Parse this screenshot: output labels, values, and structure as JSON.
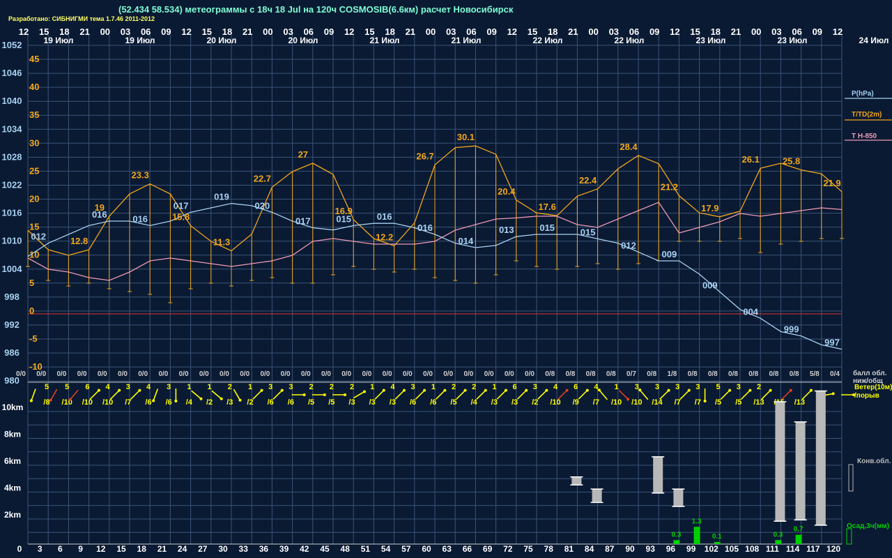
{
  "header": {
    "title": "(52.434 58.534) метеограммы с  18ч 18 Jul на 120ч COSMOSIB(6.6км) расчет Новосибирск",
    "credit": "Разработано: СИБНИГМИ тема 1.7.46 2011-2012"
  },
  "colors": {
    "bg": "#0a1a33",
    "grid": "#3a5478",
    "pressure": "#a8d0f0",
    "temperature": "#f2a71b",
    "t850": "#ef9ab4",
    "wind_yellow": "#ffff00",
    "wind_red": "#e04020",
    "precip": "#00d000",
    "cloud": "#b8b8b8",
    "zero": "#b83030"
  },
  "chart_data": {
    "type": "line",
    "hours_top": [
      "12",
      "15",
      "18",
      "21",
      "00",
      "03",
      "06",
      "09",
      "12",
      "15",
      "18",
      "21",
      "00",
      "03",
      "06",
      "09",
      "12",
      "15",
      "18",
      "21",
      "00",
      "03",
      "06",
      "09",
      "12",
      "15",
      "18",
      "21",
      "00",
      "03",
      "06",
      "09",
      "12",
      "15",
      "18",
      "21",
      "00",
      "03",
      "06",
      "09",
      "12"
    ],
    "date_labels": [
      "19 Июл",
      "19 Июл",
      "20 Июл",
      "20 Июл",
      "21 Июл",
      "21 Июл",
      "22 Июл",
      "22 Июл",
      "23 Июл",
      "23 Июл",
      "24 Июл"
    ],
    "pressure_ticks": [
      "1052",
      "1046",
      "1040",
      "1034",
      "1028",
      "1022",
      "1016",
      "1010",
      "1004",
      "998",
      "992",
      "986",
      "980"
    ],
    "temp_ticks": [
      "45",
      "40",
      "35",
      "30",
      "25",
      "20",
      "15",
      "10",
      "5",
      "0",
      "-5",
      "-10"
    ],
    "height_ticks": [
      "10km",
      "8km",
      "6km",
      "4km",
      "2km"
    ],
    "forecast_hours": [
      "0",
      "3",
      "6",
      "9",
      "12",
      "15",
      "18",
      "21",
      "24",
      "27",
      "30",
      "33",
      "36",
      "39",
      "42",
      "45",
      "48",
      "51",
      "54",
      "57",
      "60",
      "63",
      "66",
      "69",
      "72",
      "75",
      "78",
      "81",
      "84",
      "87",
      "90",
      "93",
      "96",
      "99",
      "102",
      "105",
      "108",
      "111",
      "114",
      "117",
      "120"
    ],
    "legend": {
      "pressure": "P(hPa)",
      "temperature": "T/TD(2m)",
      "t850": "T H-850",
      "clouds": "балл обл.",
      "clouds_sub": "ниж/общ",
      "wind": "Ветер(10м)",
      "gust": "/порыв",
      "conv": "Конв.обл.",
      "precip": "Осад,3ч(мм)"
    },
    "temperature": [
      15,
      11.5,
      10.5,
      11.5,
      17.5,
      21.5,
      23.3,
      21.5,
      15.8,
      13,
      11.3,
      14.3,
      22.7,
      25.5,
      27,
      25,
      16.9,
      13.5,
      12.2,
      16.3,
      26.7,
      29.8,
      30.1,
      28.6,
      20.4,
      18.1,
      17.6,
      21.1,
      22.4,
      26,
      28.4,
      26.9,
      21.2,
      18.1,
      17.4,
      18.4,
      26.1,
      27,
      25.8,
      25.1,
      21.9
    ],
    "temperature_labels": {
      "3": "12.8",
      "4": "19",
      "6": "23.3",
      "8": "15.8",
      "10": "11.3",
      "12": "22.7",
      "14": "27",
      "16": "16.9",
      "18": "12.2",
      "20": "26.7",
      "22": "30.1",
      "24": "20.4",
      "26": "17.6",
      "28": "22.4",
      "30": "28.4",
      "32": "21.2",
      "34": "17.9",
      "36": "26.1",
      "38": "25.8",
      "40": "21.9"
    },
    "dewpoint": [
      8.5,
      6,
      5,
      5.5,
      4.5,
      4,
      3.5,
      2,
      4.5,
      5.5,
      5,
      6,
      6.5,
      5.5,
      5.5,
      7,
      8.5,
      8,
      7.5,
      8,
      6.5,
      6,
      5.5,
      7,
      9.5,
      8.5,
      8,
      8.5,
      9,
      8,
      9,
      9.5,
      13,
      13,
      13,
      13.5,
      11,
      12.5,
      13,
      13.5,
      13.5
    ],
    "t850": [
      10,
      8,
      7.5,
      6.5,
      6,
      7.5,
      9.5,
      10,
      9.5,
      9,
      8.5,
      9,
      9.5,
      10.5,
      13,
      13.5,
      13,
      12.5,
      12.5,
      12.5,
      13,
      15,
      16,
      17,
      17.2,
      17.5,
      17.5,
      16,
      15.5,
      17,
      18.5,
      20,
      14.5,
      15.5,
      16.5,
      18,
      17.5,
      18,
      18.5,
      19,
      18.7
    ],
    "pressure": [
      1010,
      1013,
      1015,
      1017,
      1018,
      1018,
      1017,
      1018,
      1020,
      1021,
      1022,
      1021.5,
      1020,
      1018,
      1016.5,
      1016,
      1017,
      1017.5,
      1017.5,
      1016.5,
      1015,
      1013,
      1012,
      1012.5,
      1014.5,
      1015,
      1015,
      1015,
      1014,
      1013,
      1011,
      1009,
      1009,
      1006,
      1002,
      998,
      996,
      993,
      992,
      990,
      989
    ],
    "pressure_labels": {
      "1": "012",
      "4": "016",
      "6": "016",
      "8": "017",
      "10": "019",
      "12": "020",
      "14": "017",
      "16": "015",
      "18": "016",
      "20": "016",
      "22": "014",
      "24": "013",
      "26": "015",
      "28": "015",
      "30": "012",
      "32": "009",
      "34": "009",
      "36": "004",
      "38": "999",
      "40": "997"
    },
    "cloud_cover": [
      "0/0",
      "0/0",
      "0/0",
      "0/0",
      "0/0",
      "0/0",
      "0/0",
      "0/0",
      "0/0",
      "0/0",
      "0/0",
      "0/0",
      "0/0",
      "0/0",
      "0/0",
      "0/0",
      "0/0",
      "0/0",
      "0/0",
      "0/0",
      "0/0",
      "0/0",
      "0/0",
      "0/0",
      "0/0",
      "0/0",
      "0/8",
      "0/8",
      "0/8",
      "0/8",
      "0/7",
      "0/8",
      "1/8",
      "0/8",
      "0/8",
      "0/8",
      "0/8",
      "0/8",
      "0/8",
      "5/8",
      "0/4"
    ],
    "wind_speed": [
      "5",
      "5",
      "6",
      "4",
      "3",
      "4",
      "3",
      "1",
      "1",
      "2",
      "1",
      "3",
      "3",
      "2",
      "2",
      "2",
      "1",
      "4",
      "3",
      "1",
      "2",
      "2",
      "1",
      "6",
      "3",
      "4",
      "6",
      "4",
      "1",
      "3",
      "3",
      "3",
      "3",
      "5",
      "3",
      "2"
    ],
    "wind_gust": [
      "/8",
      "/10",
      "/10",
      "/10",
      "/7",
      "/6",
      "/6",
      "/4",
      "/2",
      "/3",
      "/2",
      "/6",
      "/6",
      "/5",
      "/5",
      "/3",
      "/3",
      "/3",
      "/6",
      "/6",
      "/5",
      "/4",
      "/3",
      "/3",
      "/2",
      "/10",
      "/9",
      "/7",
      "/10",
      "/10",
      "/14",
      "/7",
      "/7",
      "/5",
      "/5",
      "/13",
      "/15",
      "/13",
      "/4"
    ],
    "wind_dir": [
      200,
      210,
      220,
      45,
      45,
      45,
      200,
      180,
      130,
      130,
      150,
      45,
      45,
      90,
      90,
      90,
      60,
      45,
      45,
      45,
      45,
      45,
      45,
      45,
      45,
      45,
      45,
      45,
      320,
      135,
      320,
      45,
      45,
      180,
      45,
      45,
      45,
      45,
      45,
      80,
      90
    ],
    "convective_clouds_km": {
      "27": [
        4.4,
        5.0
      ],
      "28": [
        3.1,
        4.1
      ],
      "31": [
        3.8,
        6.5
      ],
      "32": [
        2.8,
        4.1
      ],
      "37": [
        1.7,
        10.6
      ],
      "38": [
        1.8,
        9.1
      ],
      "39": [
        1.4,
        11.4
      ]
    },
    "precip_mm": {
      "32": 0.3,
      "33": 1.3,
      "34": 0.1,
      "37": 0.3,
      "38": 0.7
    },
    "precip_labels": {
      "32": "0.3",
      "33": "1.3",
      "34": "0.1",
      "37": "0.3",
      "38": "0.7"
    }
  }
}
